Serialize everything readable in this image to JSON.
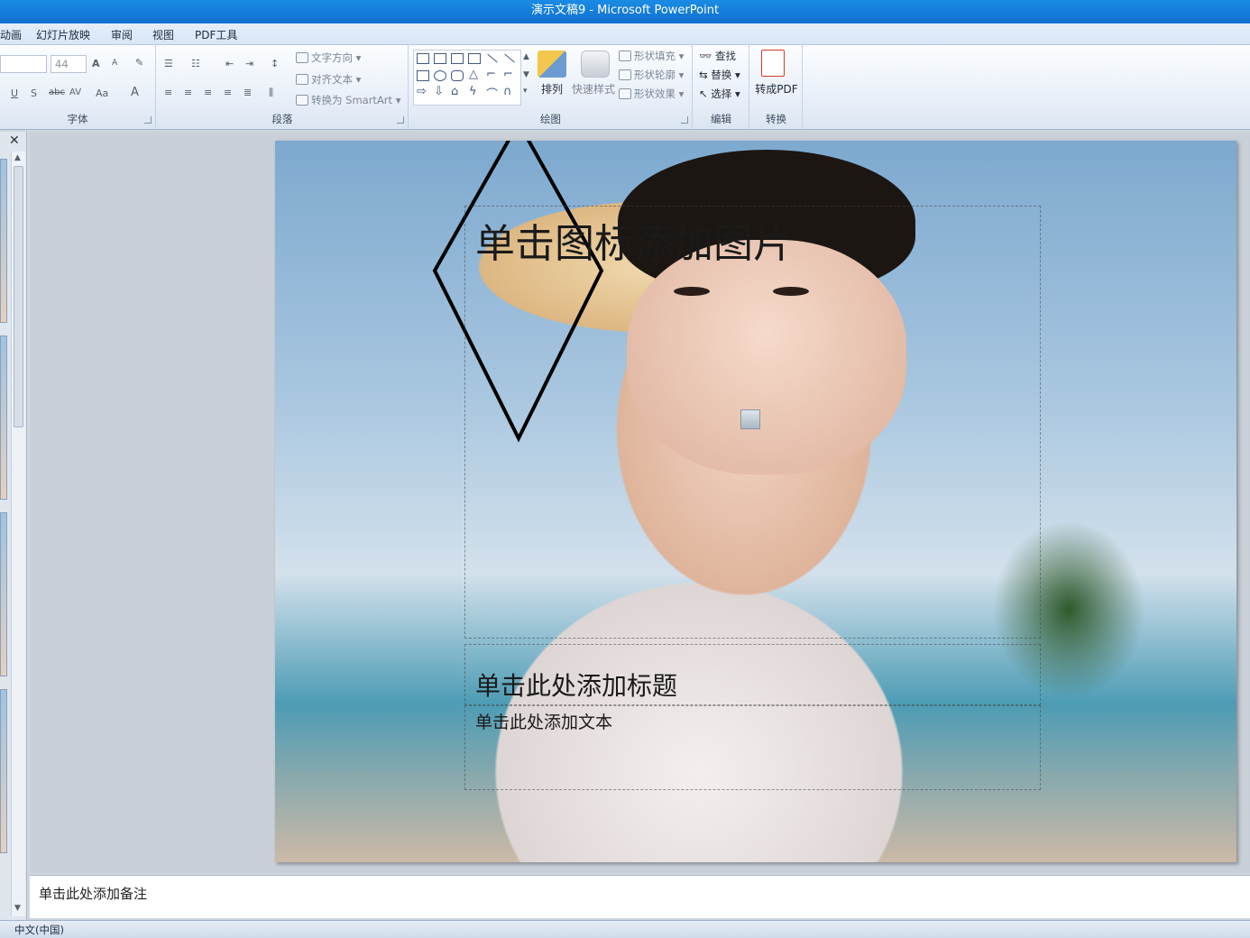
{
  "window": {
    "title": "演示文稿9 - Microsoft PowerPoint"
  },
  "menu": {
    "tabs": [
      "动画",
      "幻灯片放映",
      "审阅",
      "视图",
      "PDF工具"
    ]
  },
  "ribbon": {
    "font": {
      "label": "字体",
      "size": "44",
      "buttons": [
        "A",
        "A",
        "U",
        "S",
        "abc",
        "AV",
        "Aa",
        "A"
      ]
    },
    "paragraph": {
      "label": "段落",
      "text_direction": "文字方向",
      "align_text": "对齐文本",
      "convert_smartart": "转换为 SmartArt"
    },
    "drawing": {
      "label": "绘图",
      "arrange": "排列",
      "quick_styles": "快速样式",
      "shape_fill": "形状填充",
      "shape_outline": "形状轮廓",
      "shape_effects": "形状效果"
    },
    "editing": {
      "label": "编辑",
      "find": "查找",
      "replace": "替换",
      "select": "选择"
    },
    "convert": {
      "label": "转换",
      "to_pdf": "转成PDF"
    }
  },
  "slide": {
    "picture_placeholder": "单击图标添加图片",
    "title_placeholder": "单击此处添加标题",
    "text_placeholder": "单击此处添加文本"
  },
  "notes": {
    "placeholder": "单击此处添加备注"
  },
  "status": {
    "language": "中文(中国)"
  },
  "colors": {
    "titlebar": "#1a8ce4",
    "diamond_stroke": "#000000"
  }
}
